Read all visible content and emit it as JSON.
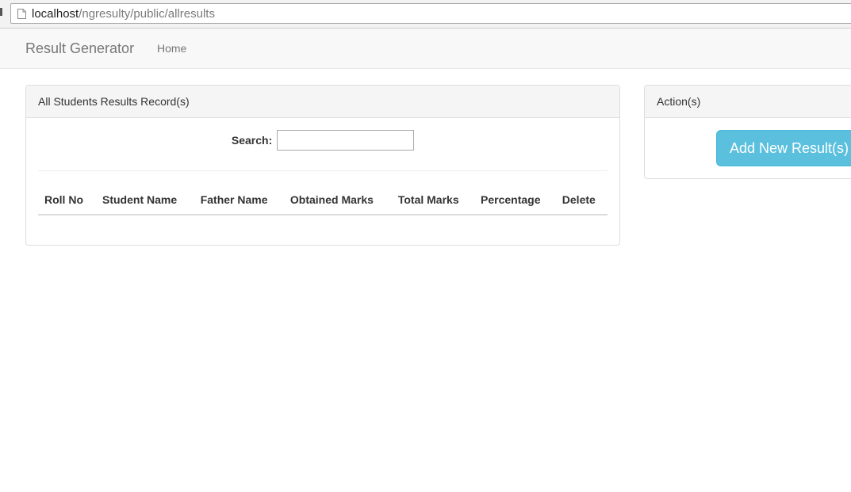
{
  "browser": {
    "url_host": "localhost",
    "url_path": "/ngresulty/public/allresults"
  },
  "navbar": {
    "brand": "Result Generator",
    "links": [
      "Home"
    ]
  },
  "results_panel": {
    "title": "All Students Results Record(s)",
    "search_label": "Search:",
    "search_value": "",
    "columns": [
      "Roll No",
      "Student Name",
      "Father Name",
      "Obtained Marks",
      "Total Marks",
      "Percentage",
      "Delete"
    ],
    "rows": []
  },
  "actions_panel": {
    "title": "Action(s)",
    "add_button_label": "Add New Result(s)"
  },
  "colors": {
    "info_button": "#5bc0de",
    "navbar_bg": "#f8f8f8",
    "panel_heading_bg": "#f5f5f5"
  }
}
